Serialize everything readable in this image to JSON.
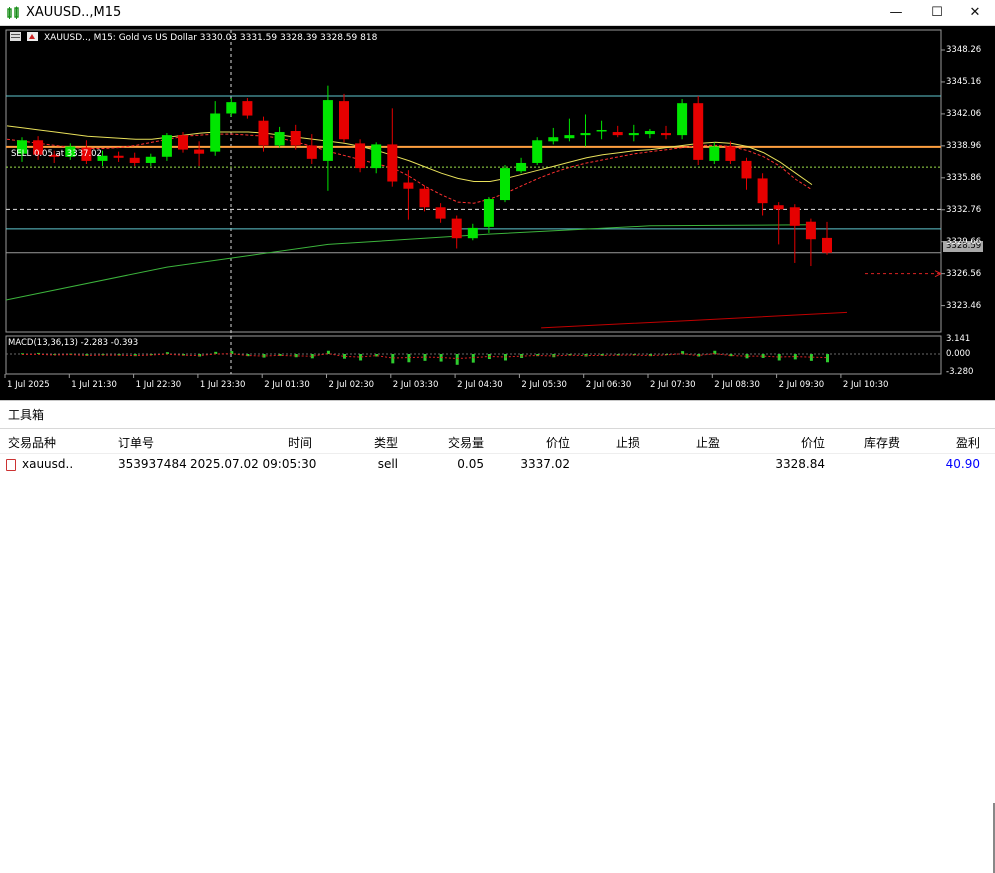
{
  "window": {
    "title": "XAUUSD..,M15",
    "icon": "chart-icon",
    "minimize": "—",
    "maximize": "☐",
    "close": "✕"
  },
  "chart": {
    "info": "XAUUSD.., M15:  Gold vs US Dollar  3330.03 3331.59 3328.39 3328.59  818",
    "sell_label": "SELL 0.05 at 3337.02",
    "macd_label": "MACD(13,36,13) -2.283 -0.393",
    "current_price": "3328.59",
    "colors": {
      "bg": "#000000",
      "up": "#00e600",
      "down": "#e60000",
      "ma_fast": "#ff3030",
      "ma_slow": "#e8e05a",
      "ma_mid": "#3cb43c",
      "ma_long": "#c00000",
      "order_line": "#ffa040"
    }
  },
  "chart_data": {
    "type": "candlestick",
    "symbol": "XAUUSD..",
    "timeframe": "M15",
    "y_ticks": [
      "3348.26",
      "3345.16",
      "3342.06",
      "3338.96",
      "3335.86",
      "3332.76",
      "3329.66",
      "3326.56",
      "3323.46"
    ],
    "macd_ticks": [
      "3.141",
      "0.000",
      "-3.280"
    ],
    "x_ticks": [
      "1 Jul 2025",
      "1 Jul 21:30",
      "1 Jul 22:30",
      "1 Jul 23:30",
      "2 Jul 01:30",
      "2 Jul 02:30",
      "2 Jul 03:30",
      "2 Jul 04:30",
      "2 Jul 05:30",
      "2 Jul 06:30",
      "2 Jul 07:30",
      "2 Jul 08:30",
      "2 Jul 09:30",
      "2 Jul 10:30"
    ],
    "ylim": [
      3320.9,
      3350.2
    ],
    "last_ohlc": {
      "open": 3330.03,
      "high": 3331.59,
      "low": 3328.39,
      "close": 3328.59
    },
    "candles": [
      {
        "o": 3338.2,
        "h": 3339.8,
        "l": 3337.4,
        "c": 3339.5
      },
      {
        "o": 3339.5,
        "h": 3339.9,
        "l": 3337.6,
        "c": 3338.1
      },
      {
        "o": 3338.1,
        "h": 3338.5,
        "l": 3337.3,
        "c": 3337.9
      },
      {
        "o": 3337.9,
        "h": 3339.2,
        "l": 3337.6,
        "c": 3338.9
      },
      {
        "o": 3338.8,
        "h": 3339.5,
        "l": 3337.2,
        "c": 3337.5
      },
      {
        "o": 3337.5,
        "h": 3338.5,
        "l": 3337.0,
        "c": 3338.0
      },
      {
        "o": 3338.0,
        "h": 3338.4,
        "l": 3337.4,
        "c": 3337.8
      },
      {
        "o": 3337.8,
        "h": 3338.3,
        "l": 3337.0,
        "c": 3337.3
      },
      {
        "o": 3337.3,
        "h": 3338.2,
        "l": 3337.0,
        "c": 3337.9
      },
      {
        "o": 3337.9,
        "h": 3340.2,
        "l": 3337.5,
        "c": 3340.0
      },
      {
        "o": 3340.0,
        "h": 3340.3,
        "l": 3338.3,
        "c": 3338.6
      },
      {
        "o": 3338.6,
        "h": 3339.4,
        "l": 3337.0,
        "c": 3338.2
      },
      {
        "o": 3338.4,
        "h": 3343.3,
        "l": 3338.0,
        "c": 3342.1
      },
      {
        "o": 3342.1,
        "h": 3343.6,
        "l": 3341.8,
        "c": 3343.2
      },
      {
        "o": 3343.3,
        "h": 3343.6,
        "l": 3341.6,
        "c": 3341.9
      },
      {
        "o": 3341.4,
        "h": 3341.8,
        "l": 3338.4,
        "c": 3339.0
      },
      {
        "o": 3339.0,
        "h": 3340.8,
        "l": 3338.8,
        "c": 3340.3
      },
      {
        "o": 3340.4,
        "h": 3341.0,
        "l": 3338.6,
        "c": 3339.0
      },
      {
        "o": 3339.0,
        "h": 3340.1,
        "l": 3337.2,
        "c": 3337.7
      },
      {
        "o": 3337.5,
        "h": 3344.8,
        "l": 3334.6,
        "c": 3343.4
      },
      {
        "o": 3343.3,
        "h": 3344.0,
        "l": 3339.3,
        "c": 3339.6
      },
      {
        "o": 3339.2,
        "h": 3339.6,
        "l": 3336.4,
        "c": 3336.8
      },
      {
        "o": 3336.8,
        "h": 3339.3,
        "l": 3336.3,
        "c": 3339.1
      },
      {
        "o": 3339.1,
        "h": 3342.6,
        "l": 3335.0,
        "c": 3335.5
      },
      {
        "o": 3335.4,
        "h": 3336.6,
        "l": 3331.8,
        "c": 3334.8
      },
      {
        "o": 3334.8,
        "h": 3335.1,
        "l": 3332.6,
        "c": 3333.0
      },
      {
        "o": 3333.0,
        "h": 3333.4,
        "l": 3331.5,
        "c": 3331.9
      },
      {
        "o": 3331.9,
        "h": 3332.2,
        "l": 3329.0,
        "c": 3330.0
      },
      {
        "o": 3330.0,
        "h": 3331.4,
        "l": 3329.8,
        "c": 3331.0
      },
      {
        "o": 3331.1,
        "h": 3334.0,
        "l": 3330.5,
        "c": 3333.8
      },
      {
        "o": 3333.7,
        "h": 3337.1,
        "l": 3333.5,
        "c": 3336.8
      },
      {
        "o": 3336.5,
        "h": 3337.8,
        "l": 3336.3,
        "c": 3337.3
      },
      {
        "o": 3337.3,
        "h": 3339.8,
        "l": 3337.1,
        "c": 3339.5
      },
      {
        "o": 3339.4,
        "h": 3340.7,
        "l": 3339.1,
        "c": 3339.8
      },
      {
        "o": 3339.7,
        "h": 3341.6,
        "l": 3339.4,
        "c": 3340.0
      },
      {
        "o": 3340.0,
        "h": 3342.0,
        "l": 3338.9,
        "c": 3340.2
      },
      {
        "o": 3340.5,
        "h": 3341.4,
        "l": 3339.6,
        "c": 3340.5
      },
      {
        "o": 3340.3,
        "h": 3340.9,
        "l": 3339.8,
        "c": 3340.0
      },
      {
        "o": 3340.0,
        "h": 3341.0,
        "l": 3339.4,
        "c": 3340.2
      },
      {
        "o": 3340.1,
        "h": 3340.6,
        "l": 3339.7,
        "c": 3340.4
      },
      {
        "o": 3340.2,
        "h": 3340.9,
        "l": 3339.6,
        "c": 3340.0
      },
      {
        "o": 3340.0,
        "h": 3343.5,
        "l": 3339.6,
        "c": 3343.1
      },
      {
        "o": 3343.1,
        "h": 3343.8,
        "l": 3337.1,
        "c": 3337.6
      },
      {
        "o": 3337.5,
        "h": 3339.3,
        "l": 3337.2,
        "c": 3338.9
      },
      {
        "o": 3338.9,
        "h": 3339.4,
        "l": 3337.2,
        "c": 3337.5
      },
      {
        "o": 3337.5,
        "h": 3337.8,
        "l": 3334.7,
        "c": 3335.8
      },
      {
        "o": 3335.8,
        "h": 3336.3,
        "l": 3332.2,
        "c": 3333.4
      },
      {
        "o": 3333.2,
        "h": 3333.5,
        "l": 3329.4,
        "c": 3332.8
      },
      {
        "o": 3333.0,
        "h": 3333.3,
        "l": 3327.6,
        "c": 3331.2
      },
      {
        "o": 3331.6,
        "h": 3331.9,
        "l": 3327.3,
        "c": 3329.9
      },
      {
        "o": 3330.03,
        "h": 3331.59,
        "l": 3328.39,
        "c": 3328.59
      }
    ],
    "macd": [
      0.2,
      0.3,
      -0.2,
      0.1,
      -0.5,
      -0.3,
      -0.4,
      -0.6,
      -0.3,
      0.5,
      -0.4,
      -0.7,
      0.6,
      0.8,
      -0.6,
      -1.0,
      -0.5,
      -0.9,
      -1.2,
      0.9,
      -1.3,
      -1.8,
      -0.7,
      -2.6,
      -2.3,
      -1.9,
      -2.1,
      -3.0,
      -2.4,
      -1.4,
      -1.8,
      -1.1,
      -0.6,
      -0.9,
      -0.4,
      -0.7,
      -0.5,
      -0.4,
      -0.3,
      -0.6,
      -0.2,
      0.8,
      -0.7,
      0.9,
      -0.6,
      -1.2,
      -1.1,
      -1.8,
      -1.5,
      -1.9,
      -2.3
    ],
    "ma_fast": [
      3339.6,
      3339.4,
      3339.2,
      3339.0,
      3338.8,
      3338.7,
      3338.7,
      3338.8,
      3339.0,
      3339.3,
      3339.6,
      3339.9,
      3340.0,
      3340.1,
      3340.1,
      3340.0,
      3339.9,
      3339.7,
      3339.3,
      3338.9,
      3338.4,
      3338.0,
      3337.6,
      3337.2,
      3336.8,
      3336.0,
      3335.0,
      3334.2,
      3333.5,
      3333.4,
      3333.8,
      3334.4,
      3335.1,
      3335.8,
      3336.4,
      3336.9,
      3337.3,
      3337.6,
      3337.9,
      3338.2,
      3338.4,
      3338.6,
      3338.8,
      3339.0,
      3339.0,
      3338.9,
      3338.5,
      3337.9,
      3337.0,
      3335.7,
      3334.7
    ],
    "ma_slow": [
      3340.9,
      3340.7,
      3340.5,
      3340.3,
      3340.1,
      3339.9,
      3339.8,
      3339.7,
      3339.6,
      3339.6,
      3339.8,
      3340.0,
      3340.2,
      3340.3,
      3340.3,
      3340.3,
      3340.2,
      3340.0,
      3339.8,
      3339.6,
      3339.4,
      3339.2,
      3338.9,
      3338.5,
      3338.0,
      3337.5,
      3336.9,
      3336.3,
      3335.8,
      3335.5,
      3335.5,
      3335.8,
      3336.2,
      3336.6,
      3337.0,
      3337.4,
      3337.8,
      3338.1,
      3338.3,
      3338.5,
      3338.6,
      3338.8,
      3339.0,
      3339.2,
      3339.3,
      3339.2,
      3338.9,
      3338.3,
      3337.4,
      3336.3,
      3335.2
    ],
    "ma_mid": [
      [
        0,
        3324.0
      ],
      [
        10,
        3327.2
      ],
      [
        20,
        3329.4
      ],
      [
        30,
        3330.4
      ],
      [
        40,
        3331.2
      ],
      [
        50,
        3331.3
      ]
    ],
    "ma_long": [
      [
        31,
        3321.3
      ],
      [
        40,
        3322.0
      ],
      [
        50,
        3322.8
      ]
    ],
    "h_lines": {
      "resistance_top": 3343.8,
      "order_price": 3338.96,
      "green_dashed": 3336.9,
      "white_dashed": 3332.8,
      "support_cyan": 3330.9,
      "current": 3328.59,
      "red_dashed": 3326.56
    }
  },
  "toolbox": {
    "title": "工具箱",
    "columns": [
      "交易品种",
      "订单号",
      "时间",
      "类型",
      "交易量",
      "价位",
      "止损",
      "止盈",
      "价位",
      "库存费",
      "盈利"
    ],
    "row": {
      "symbol": "xauusd..",
      "ticket": "353937484",
      "time": "2025.07.02 09:05:30",
      "type": "sell",
      "volume": "0.05",
      "open_price": "3337.02",
      "sl": "",
      "tp": "",
      "price": "3328.84",
      "swap": "",
      "profit": "40.90",
      "profit_color": "#0000ff"
    }
  }
}
